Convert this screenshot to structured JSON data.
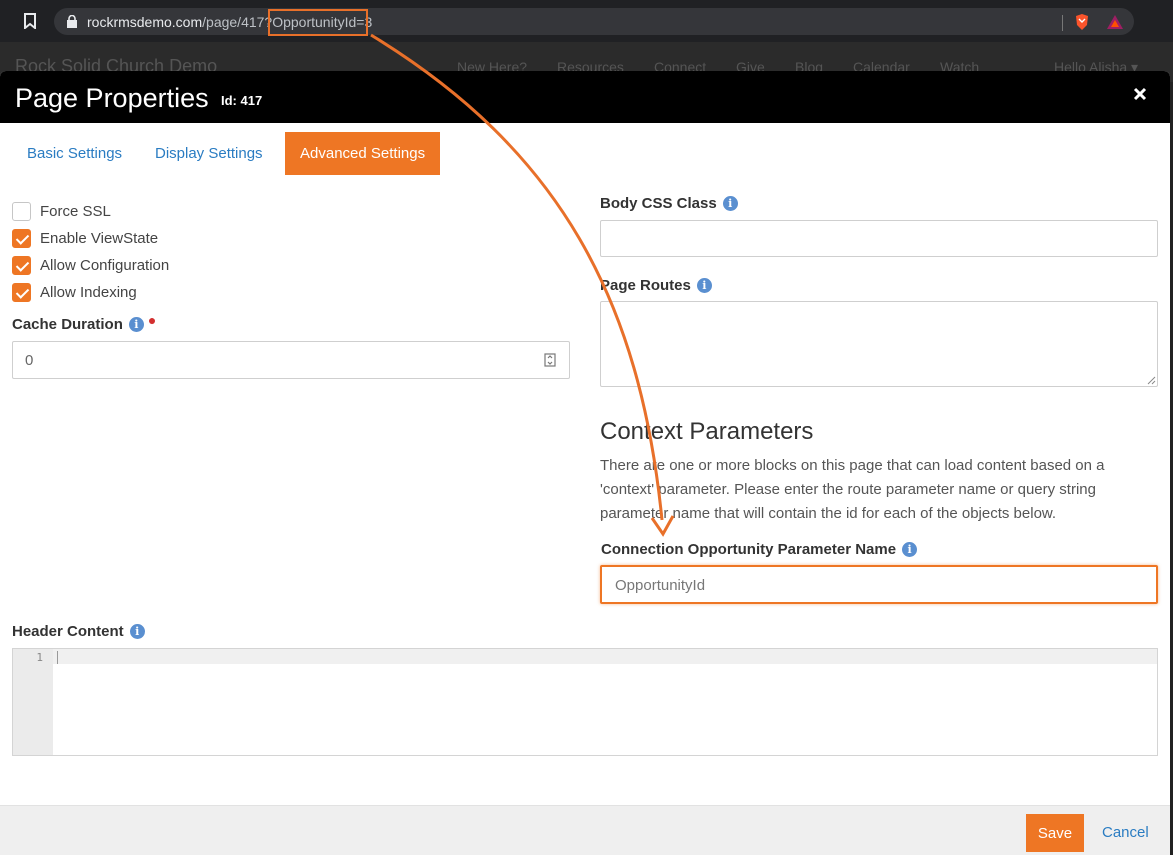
{
  "browser": {
    "url_host": "rockrmsdemo.com",
    "url_path": "/page/417?",
    "url_query_highlight": "OpportunityId",
    "url_query_rest": "=3"
  },
  "site": {
    "title": "Rock Solid Church Demo",
    "nav": [
      "New Here?",
      "Resources",
      "Connect",
      "Give",
      "Blog",
      "Calendar",
      "Watch"
    ],
    "user_menu": "Hello Alisha"
  },
  "modal": {
    "title": "Page Properties",
    "id_label": "Id: 417",
    "tabs": [
      "Basic Settings",
      "Display Settings",
      "Advanced Settings"
    ],
    "active_tab": "Advanced Settings"
  },
  "settings": {
    "checkboxes": [
      {
        "label": "Force SSL",
        "checked": false
      },
      {
        "label": "Enable ViewState",
        "checked": true
      },
      {
        "label": "Allow Configuration",
        "checked": true
      },
      {
        "label": "Allow Indexing",
        "checked": true
      }
    ],
    "cache_duration_label": "Cache Duration",
    "cache_duration_value": "0",
    "body_css_label": "Body CSS Class",
    "body_css_value": "",
    "page_routes_label": "Page Routes",
    "page_routes_value": ""
  },
  "context": {
    "title": "Context Parameters",
    "description": "There are one or more blocks on this page that can load content based on a 'context' parameter. Please enter the route parameter name or query string parameter name that will contain the id for each of the objects below.",
    "param_label": "Connection Opportunity Parameter Name",
    "param_value": "OpportunityId"
  },
  "header_content": {
    "label": "Header Content",
    "line_number": "1"
  },
  "footer": {
    "save_label": "Save",
    "cancel_label": "Cancel"
  },
  "colors": {
    "accent": "#ee7624",
    "link": "#2a7cc2",
    "info": "#5a8fd0",
    "annotation": "#e8702a"
  }
}
